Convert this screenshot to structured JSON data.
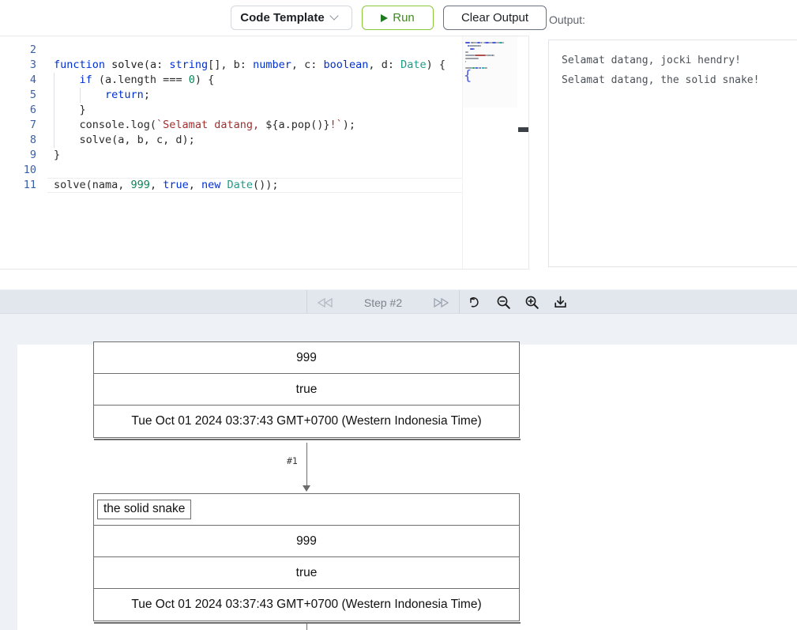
{
  "toolbar": {
    "template_label": "Code Template",
    "template_caret": "chevron-down",
    "run_label": "Run",
    "clear_label": "Clear Output"
  },
  "output": {
    "heading": "Output:",
    "lines": [
      "Selamat datang, jocki hendry!",
      "Selamat datang, the solid snake!"
    ]
  },
  "editor": {
    "lines": [
      {
        "no": "2",
        "tokens": []
      },
      {
        "no": "3",
        "tokens": [
          {
            "t": "function",
            "c": "kw"
          },
          {
            "t": " ",
            "c": "pun"
          },
          {
            "t": "solve",
            "c": "fn"
          },
          {
            "t": "(",
            "c": "pun"
          },
          {
            "t": "a",
            "c": "pun"
          },
          {
            "t": ": ",
            "c": "pun"
          },
          {
            "t": "string",
            "c": "kw"
          },
          {
            "t": "[], ",
            "c": "pun"
          },
          {
            "t": "b",
            "c": "pun"
          },
          {
            "t": ": ",
            "c": "pun"
          },
          {
            "t": "number",
            "c": "kw"
          },
          {
            "t": ", ",
            "c": "pun"
          },
          {
            "t": "c",
            "c": "pun"
          },
          {
            "t": ": ",
            "c": "pun"
          },
          {
            "t": "boolean",
            "c": "kw"
          },
          {
            "t": ", ",
            "c": "pun"
          },
          {
            "t": "d",
            "c": "pun"
          },
          {
            "t": ": ",
            "c": "pun"
          },
          {
            "t": "Date",
            "c": "typ"
          },
          {
            "t": ") {",
            "c": "pun"
          }
        ]
      },
      {
        "no": "4",
        "tokens": [
          {
            "t": "    ",
            "c": "pun"
          },
          {
            "t": "if",
            "c": "kw"
          },
          {
            "t": " (a.length === ",
            "c": "pun"
          },
          {
            "t": "0",
            "c": "num"
          },
          {
            "t": ") {",
            "c": "pun"
          }
        ]
      },
      {
        "no": "5",
        "tokens": [
          {
            "t": "        ",
            "c": "pun"
          },
          {
            "t": "return",
            "c": "kw"
          },
          {
            "t": ";",
            "c": "pun"
          }
        ]
      },
      {
        "no": "6",
        "tokens": [
          {
            "t": "    }",
            "c": "pun"
          }
        ]
      },
      {
        "no": "7",
        "tokens": [
          {
            "t": "    console.log(",
            "c": "pun"
          },
          {
            "t": "`Selamat datang, ",
            "c": "str"
          },
          {
            "t": "${",
            "c": "pun"
          },
          {
            "t": "a.pop()",
            "c": "pun"
          },
          {
            "t": "}",
            "c": "pun"
          },
          {
            "t": "!`",
            "c": "str"
          },
          {
            "t": ");",
            "c": "pun"
          }
        ]
      },
      {
        "no": "8",
        "tokens": [
          {
            "t": "    solve(a, b, c, d);",
            "c": "pun"
          }
        ]
      },
      {
        "no": "9",
        "tokens": [
          {
            "t": "}",
            "c": "pun"
          }
        ]
      },
      {
        "no": "10",
        "tokens": []
      },
      {
        "no": "11",
        "tokens": [
          {
            "t": "solve(nama, ",
            "c": "pun"
          },
          {
            "t": "999",
            "c": "num"
          },
          {
            "t": ", ",
            "c": "pun"
          },
          {
            "t": "true",
            "c": "kw"
          },
          {
            "t": ", ",
            "c": "pun"
          },
          {
            "t": "new",
            "c": "kw"
          },
          {
            "t": " ",
            "c": "pun"
          },
          {
            "t": "Date",
            "c": "typ"
          },
          {
            "t": "());",
            "c": "pun"
          }
        ]
      }
    ]
  },
  "steptoolbar": {
    "prev_icon": "step-back-icon",
    "next_icon": "step-forward-icon",
    "step_label": "Step #2",
    "reset_icon": "undo-icon",
    "zoom_out_icon": "zoom-out-icon",
    "zoom_in_icon": "zoom-in-icon",
    "download_icon": "download-icon"
  },
  "diagram": {
    "frames": [
      {
        "rows": [
          {
            "value": "999",
            "chip": false
          },
          {
            "value": "true",
            "chip": false
          },
          {
            "value": "Tue Oct 01 2024 03:37:43 GMT+0700 (Western Indonesia Time)",
            "chip": false
          }
        ]
      },
      {
        "rows": [
          {
            "value": "the solid snake",
            "chip": true
          },
          {
            "value": "999",
            "chip": false
          },
          {
            "value": "true",
            "chip": false
          },
          {
            "value": "Tue Oct 01 2024 03:37:43 GMT+0700 (Western Indonesia Time)",
            "chip": false
          }
        ]
      }
    ],
    "connector_label": "#1"
  },
  "colors": {
    "accent_green": "#8cc63f",
    "run_text": "#3f8a20",
    "toolbar_bg": "#e2e6ed",
    "canvas_bg": "#eef1f6",
    "box_border": "#6e6e6e"
  }
}
